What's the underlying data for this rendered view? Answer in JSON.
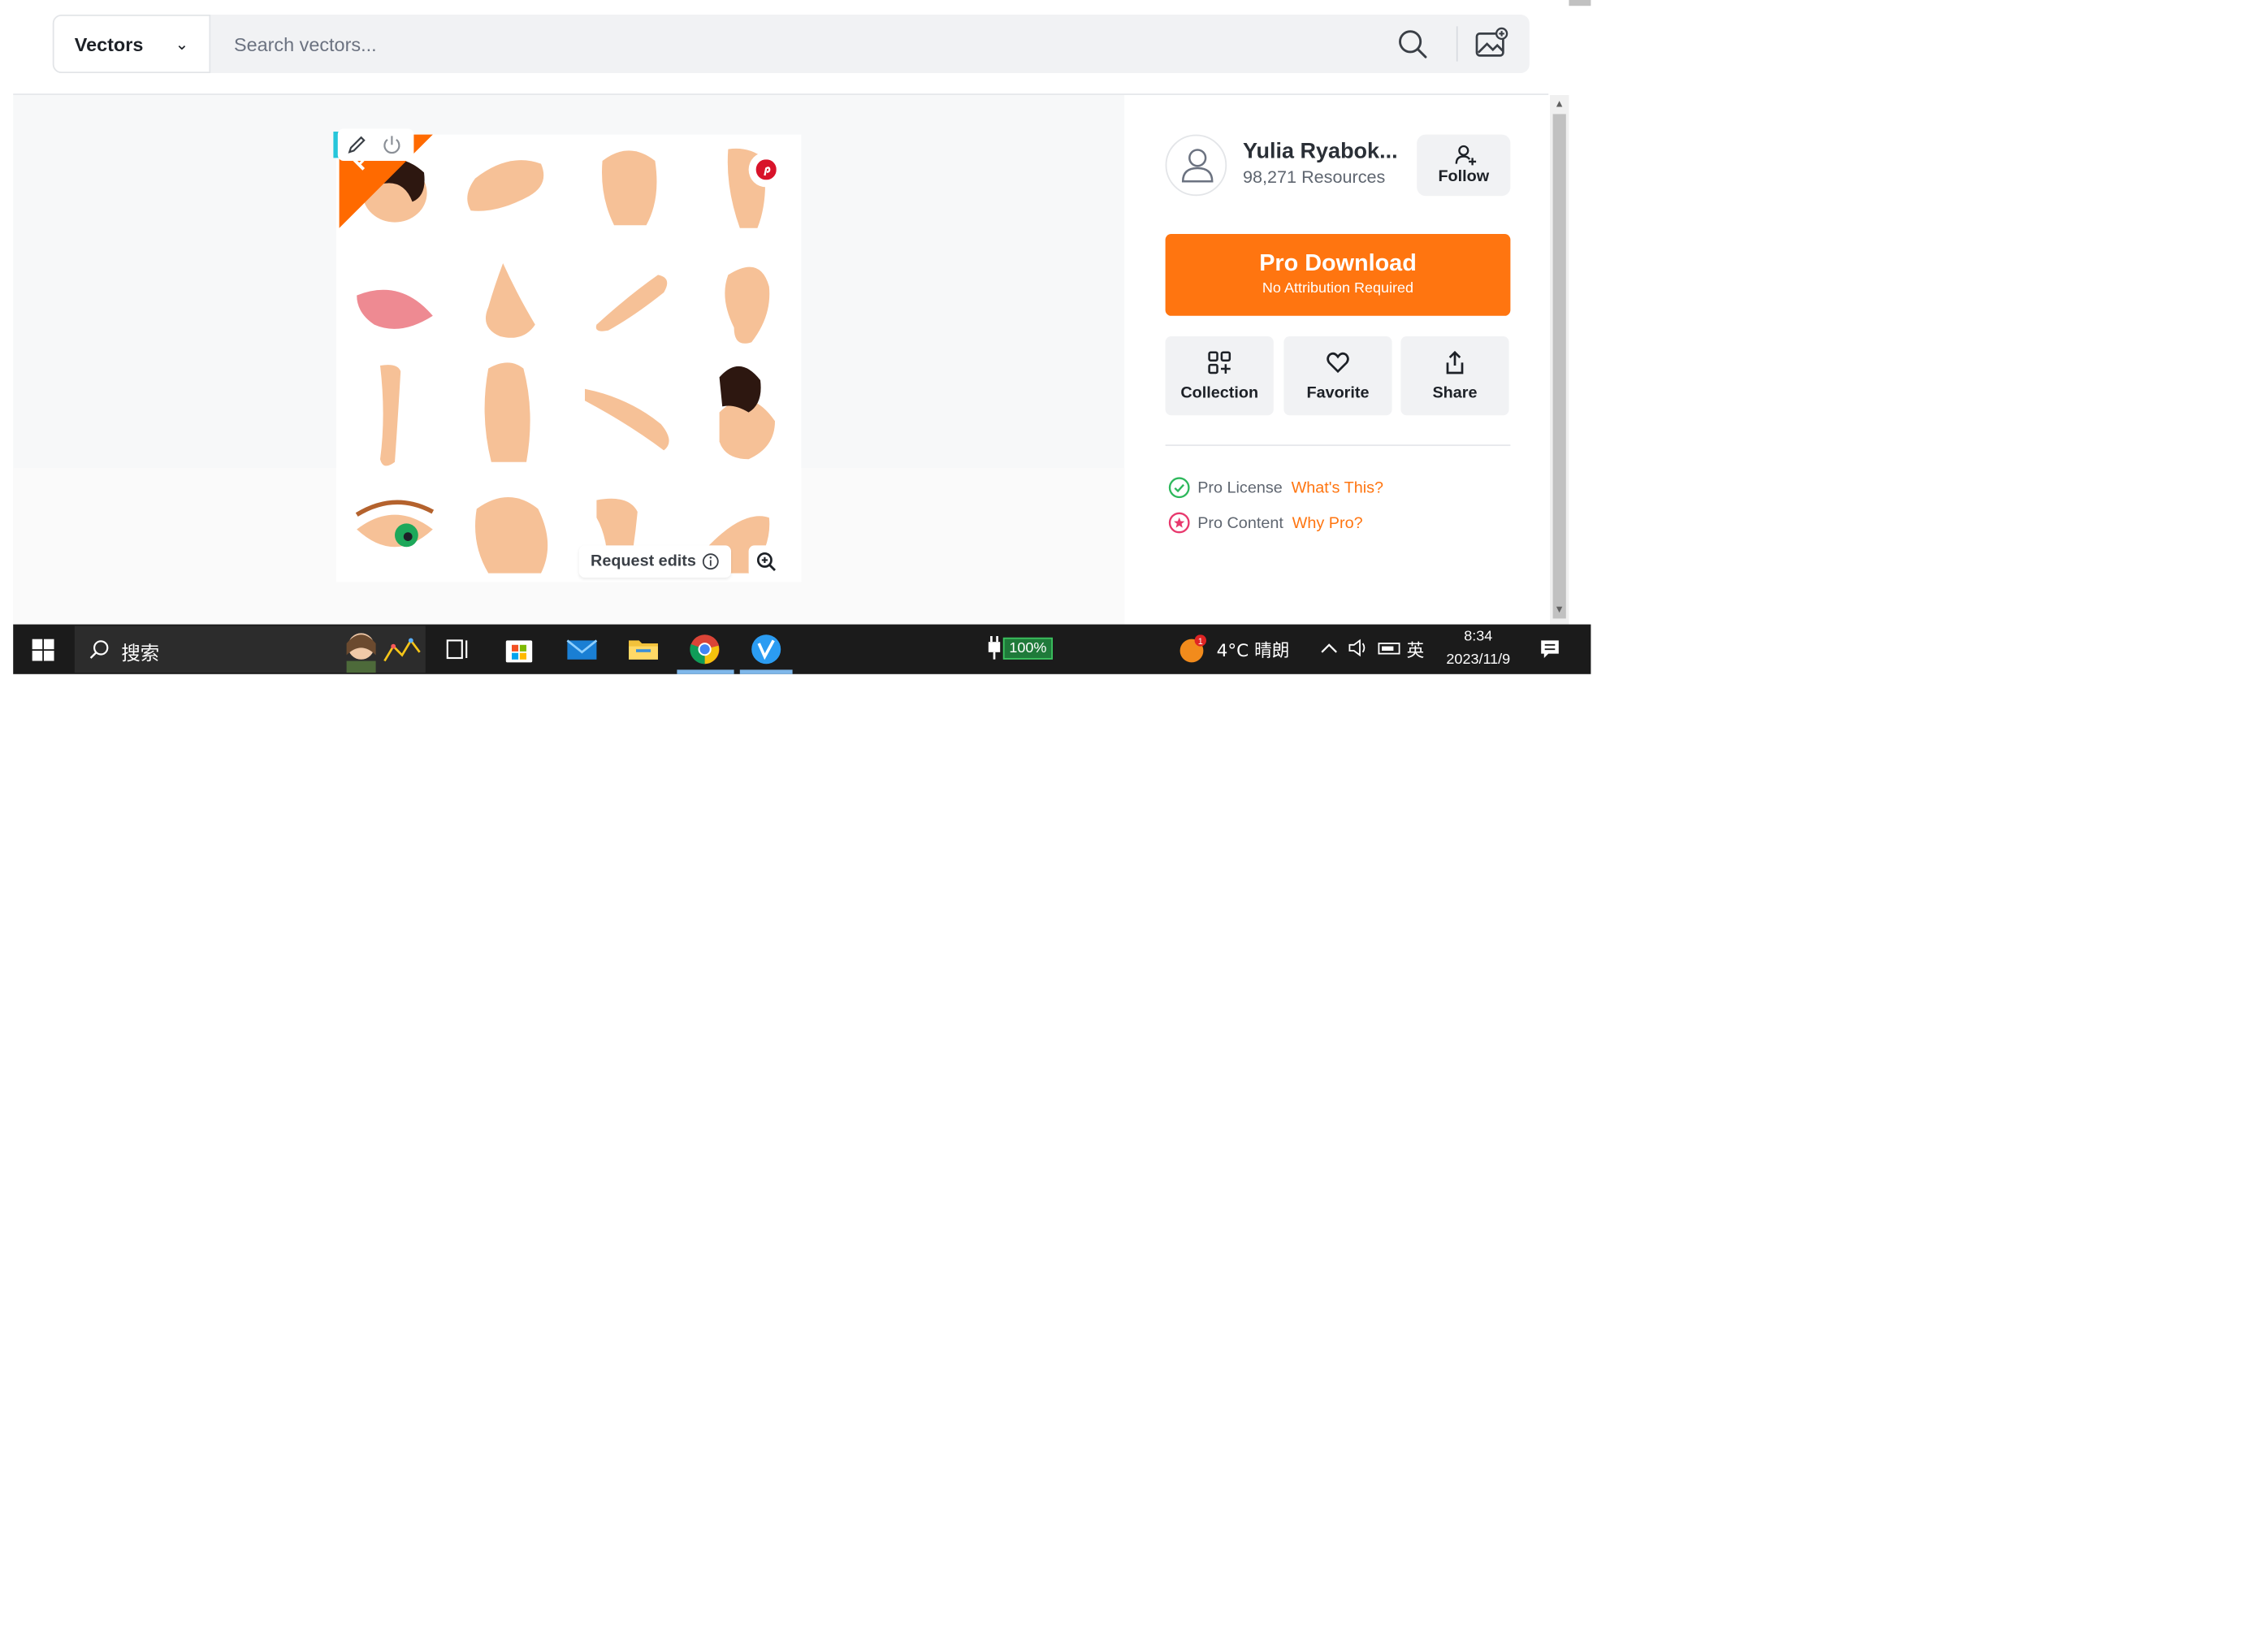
{
  "search": {
    "category": "Vectors",
    "placeholder": "Search vectors..."
  },
  "preview": {
    "badge": "Pro",
    "request_edits": "Request edits",
    "colors": {
      "skin": "#f6c197",
      "hair": "#2d1710",
      "lip": "#ee8a92",
      "iris": "#1da85a"
    }
  },
  "author": {
    "name": "Yulia Ryabok...",
    "resources": "98,271 Resources",
    "follow_label": "Follow"
  },
  "download": {
    "title": "Pro Download",
    "subtitle": "No Attribution Required",
    "color": "#ff7510"
  },
  "actions": [
    {
      "label": "Collection",
      "icon": "collection-icon"
    },
    {
      "label": "Favorite",
      "icon": "heart-icon"
    },
    {
      "label": "Share",
      "icon": "share-icon"
    }
  ],
  "license": {
    "license_label": "Pro License",
    "license_link": "What's This?",
    "content_label": "Pro Content",
    "content_link": "Why Pro?"
  },
  "taskbar": {
    "search_text": "搜索",
    "battery": "100%",
    "weather": "4°C  晴朗",
    "ime": "英",
    "time": "8:34",
    "date": "2023/11/9"
  }
}
